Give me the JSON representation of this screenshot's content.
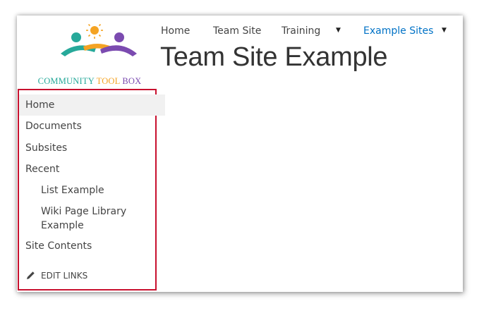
{
  "logo": {
    "word1": "COMMUNITY",
    "word2": "TOOL",
    "word3": "BOX",
    "colors": {
      "teal": "#27a99a",
      "orange": "#f4a323",
      "purple": "#7b4bb0"
    },
    "icon": "community-people-sun-icon"
  },
  "topnav": {
    "items": [
      {
        "label": "Home"
      },
      {
        "label": "Team Site"
      },
      {
        "label": "Training",
        "has_dropdown": true
      },
      {
        "label": "Example Sites",
        "has_dropdown": true,
        "active": true
      }
    ],
    "active_color": "#0072c6"
  },
  "page": {
    "title": "Team Site Example"
  },
  "left_nav": {
    "highlight_color": "#c8102e",
    "items": [
      {
        "label": "Home",
        "selected": true
      },
      {
        "label": "Documents"
      },
      {
        "label": "Subsites"
      },
      {
        "label": "Recent"
      },
      {
        "label": "List Example",
        "level": 2
      },
      {
        "label": "Wiki Page Library Example",
        "level": 2
      },
      {
        "label": "Site Contents"
      }
    ],
    "edit_links": {
      "label": "EDIT LINKS",
      "icon": "pencil-icon"
    }
  }
}
